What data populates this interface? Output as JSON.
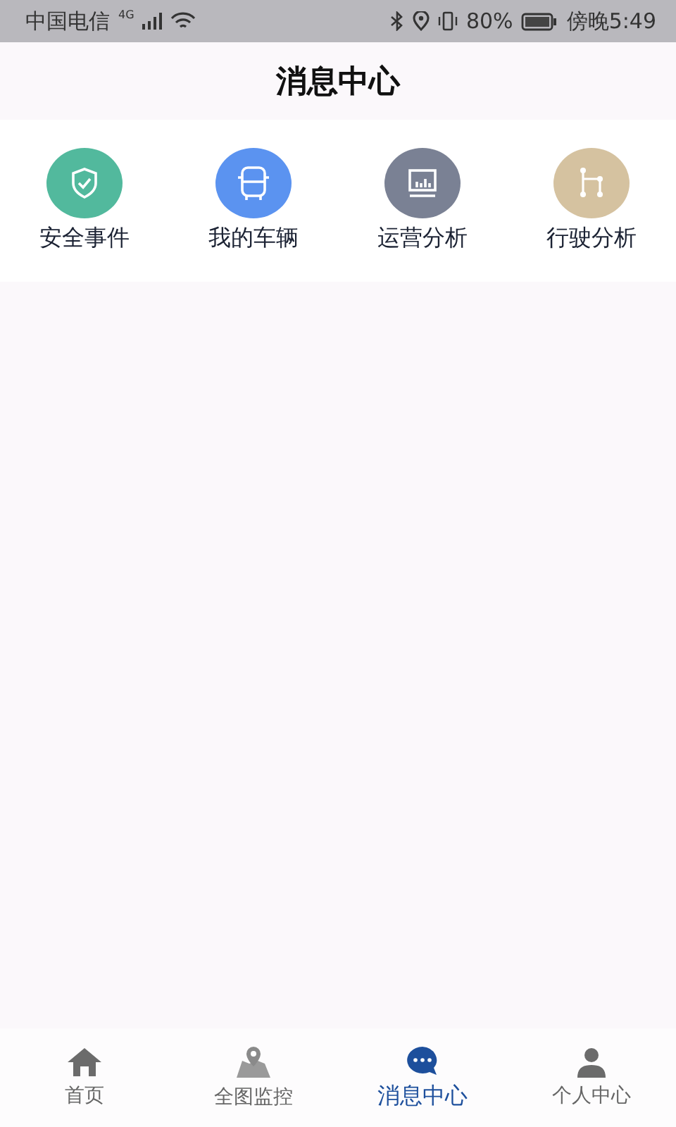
{
  "status_bar": {
    "carrier": "中国电信",
    "network": "4G",
    "battery": "80%",
    "time": "傍晚5:49"
  },
  "header": {
    "title": "消息中心"
  },
  "shortcuts": [
    {
      "label": "安全事件",
      "kind": "shield",
      "color": "#52b99d"
    },
    {
      "label": "我的车辆",
      "kind": "bus",
      "color": "#5b93f0"
    },
    {
      "label": "运营分析",
      "kind": "chart",
      "color": "#7a8194"
    },
    {
      "label": "行驶分析",
      "kind": "route",
      "color": "#d5c2a0"
    }
  ],
  "tabs": [
    {
      "label": "首页",
      "kind": "home",
      "selected": false
    },
    {
      "label": "全图监控",
      "kind": "map",
      "selected": false
    },
    {
      "label": "消息中心",
      "kind": "message",
      "selected": true
    },
    {
      "label": "个人中心",
      "kind": "person",
      "selected": false
    }
  ]
}
